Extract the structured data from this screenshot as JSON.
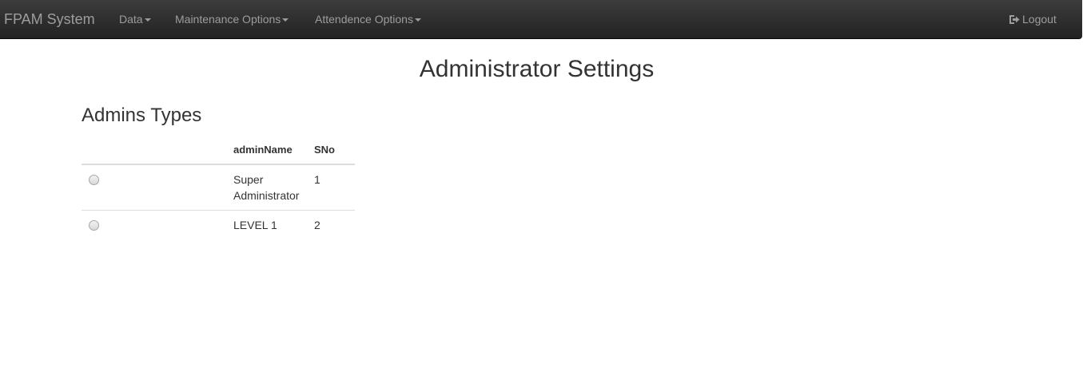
{
  "navbar": {
    "brand": "FPAM System",
    "menus": [
      {
        "label": "Data"
      },
      {
        "label": "Maintenance Options"
      },
      {
        "label": "Attendence Options"
      }
    ],
    "logout_label": "Logout"
  },
  "page": {
    "title": "Administrator Settings",
    "section_title": "Admins Types"
  },
  "table": {
    "columns": [
      "",
      "adminName",
      "SNo"
    ],
    "rows": [
      {
        "adminName": "Super Administrator",
        "SNo": "1"
      },
      {
        "adminName": "LEVEL 1",
        "SNo": "2"
      }
    ]
  },
  "colors": {
    "navbar_bg": "#222222",
    "nav_text": "#9d9d9d",
    "text": "#333333",
    "border": "#dddddd"
  }
}
